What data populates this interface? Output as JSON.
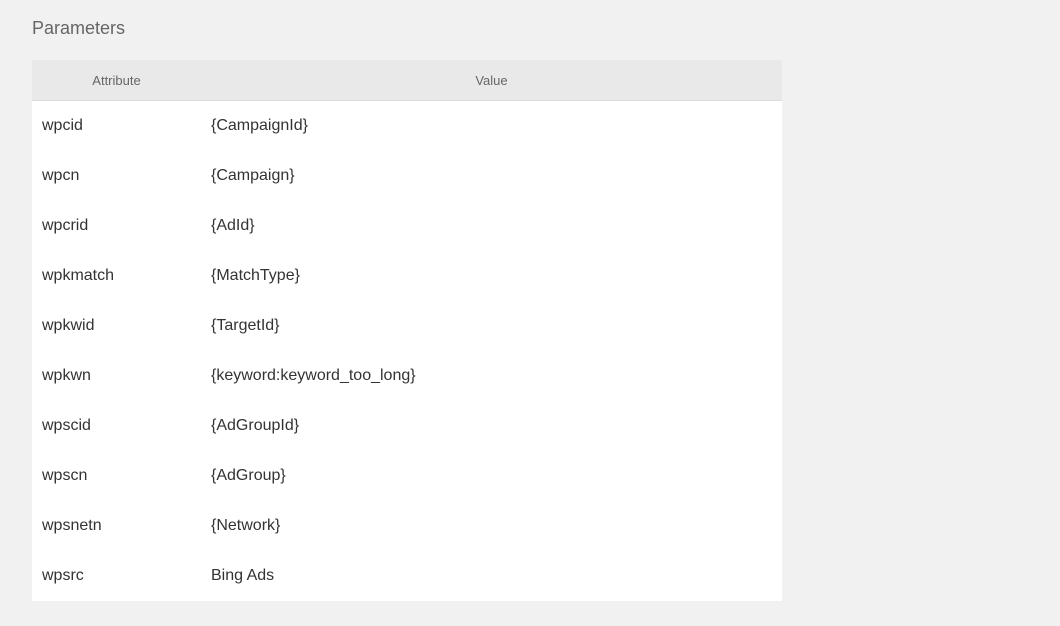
{
  "section": {
    "title": "Parameters"
  },
  "table": {
    "headers": {
      "attribute": "Attribute",
      "value": "Value"
    },
    "rows": [
      {
        "attribute": "wpcid",
        "value": "{CampaignId}"
      },
      {
        "attribute": "wpcn",
        "value": "{Campaign}"
      },
      {
        "attribute": "wpcrid",
        "value": "{AdId}"
      },
      {
        "attribute": "wpkmatch",
        "value": "{MatchType}"
      },
      {
        "attribute": "wpkwid",
        "value": "{TargetId}"
      },
      {
        "attribute": "wpkwn",
        "value": "{keyword:keyword_too_long}"
      },
      {
        "attribute": "wpscid",
        "value": "{AdGroupId}"
      },
      {
        "attribute": "wpscn",
        "value": "{AdGroup}"
      },
      {
        "attribute": "wpsnetn",
        "value": "{Network}"
      },
      {
        "attribute": "wpsrc",
        "value": "Bing Ads"
      }
    ]
  }
}
